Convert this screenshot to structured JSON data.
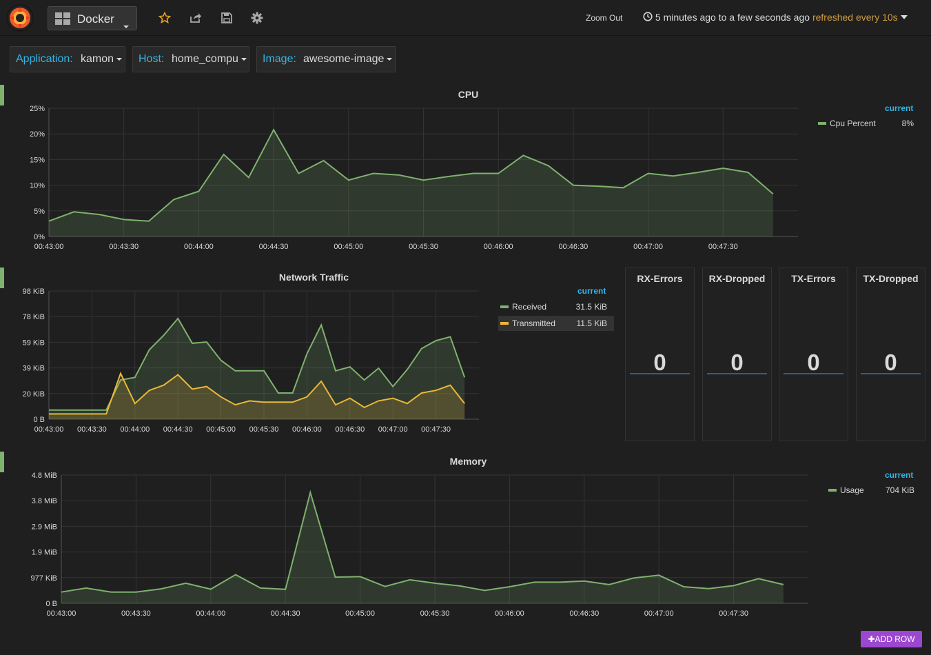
{
  "nav": {
    "dashboard_title": "Docker",
    "zoom_out": "Zoom Out",
    "time_range": "5 minutes ago to a few seconds ago",
    "refresh": "refreshed every 10s"
  },
  "variables": [
    {
      "label": "Application:",
      "value": "kamon"
    },
    {
      "label": "Host:",
      "value": "home_compu"
    },
    {
      "label": "Image:",
      "value": "awesome-image"
    }
  ],
  "cpu": {
    "title": "CPU",
    "legend_header": "current",
    "legend": [
      {
        "name": "Cpu Percent",
        "value": "8%",
        "color": "#7eb26d"
      }
    ]
  },
  "network": {
    "title": "Network Traffic",
    "legend_header": "current",
    "legend": [
      {
        "name": "Received",
        "value": "31.5 KiB",
        "color": "#7eb26d"
      },
      {
        "name": "Transmitted",
        "value": "11.5 KiB",
        "color": "#eab839"
      }
    ]
  },
  "stats": [
    {
      "title": "RX-Errors",
      "value": "0"
    },
    {
      "title": "RX-Dropped",
      "value": "0"
    },
    {
      "title": "TX-Errors",
      "value": "0"
    },
    {
      "title": "TX-Dropped",
      "value": "0"
    }
  ],
  "memory": {
    "title": "Memory",
    "legend_header": "current",
    "legend": [
      {
        "name": "Usage",
        "value": "704 KiB",
        "color": "#7eb26d"
      }
    ]
  },
  "add_row": "ADD ROW",
  "chart_data": [
    {
      "type": "area",
      "title": "CPU",
      "x_ticks": [
        "00:43:00",
        "00:43:30",
        "00:44:00",
        "00:44:30",
        "00:45:00",
        "00:45:30",
        "00:46:00",
        "00:46:30",
        "00:47:00",
        "00:47:30"
      ],
      "y_ticks": [
        "0%",
        "5%",
        "10%",
        "15%",
        "20%",
        "25%"
      ],
      "ylim": [
        0,
        25
      ],
      "x": [
        0,
        10,
        20,
        30,
        40,
        50,
        60,
        70,
        80,
        90,
        100,
        110,
        120,
        130,
        140,
        150,
        160,
        170,
        180,
        190,
        200,
        210,
        220,
        230,
        240,
        250,
        260,
        270,
        280,
        290
      ],
      "series": [
        {
          "name": "Cpu Percent",
          "values": [
            3.0,
            4.8,
            4.3,
            3.3,
            3.0,
            7.2,
            8.8,
            16.0,
            11.5,
            20.8,
            12.3,
            14.8,
            11.0,
            12.3,
            12.0,
            11.0,
            11.7,
            12.3,
            12.3,
            15.8,
            13.8,
            10.0,
            9.8,
            9.5,
            12.3,
            11.8,
            12.5,
            13.3,
            12.5,
            8.3
          ]
        }
      ]
    },
    {
      "type": "area",
      "title": "Network Traffic",
      "x_ticks": [
        "00:43:00",
        "00:43:30",
        "00:44:00",
        "00:44:30",
        "00:45:00",
        "00:45:30",
        "00:46:00",
        "00:46:30",
        "00:47:00",
        "00:47:30"
      ],
      "y_ticks": [
        "0 B",
        "20 KiB",
        "39 KiB",
        "59 KiB",
        "78 KiB",
        "98 KiB"
      ],
      "ylim": [
        0,
        98
      ],
      "x": [
        0,
        10,
        20,
        30,
        40,
        45,
        50,
        55,
        60,
        65,
        70,
        75,
        80,
        85,
        90,
        95,
        100,
        105,
        110,
        115,
        120,
        125,
        130,
        135,
        140,
        145,
        150,
        155,
        160,
        165,
        170,
        175,
        180,
        185,
        190,
        195,
        200,
        205,
        210,
        215,
        220,
        225,
        230,
        235,
        240,
        245,
        250,
        255,
        260,
        265,
        270,
        275,
        280,
        285,
        290
      ],
      "series": [
        {
          "name": "Received",
          "values": [
            7,
            7,
            7,
            7,
            7,
            30,
            32,
            53,
            64,
            77,
            58,
            59,
            45,
            37,
            37,
            37,
            20,
            20,
            50,
            72,
            37,
            40,
            30,
            39,
            25,
            38,
            54,
            60,
            63,
            32
          ]
        },
        {
          "name": "Transmitted",
          "values": [
            4,
            4,
            4,
            4,
            4,
            35,
            12,
            22,
            26,
            34,
            23,
            25,
            17,
            11,
            14,
            13,
            13,
            13,
            17,
            29,
            11,
            16,
            9,
            14,
            16,
            12,
            20,
            22,
            26,
            12
          ]
        }
      ]
    },
    {
      "type": "area",
      "title": "Memory",
      "x_ticks": [
        "00:43:00",
        "00:43:30",
        "00:44:00",
        "00:44:30",
        "00:45:00",
        "00:45:30",
        "00:46:00",
        "00:46:30",
        "00:47:00",
        "00:47:30"
      ],
      "y_ticks": [
        "0 B",
        "977 KiB",
        "1.9 MiB",
        "2.9 MiB",
        "3.8 MiB",
        "4.8 MiB"
      ],
      "ylim": [
        0,
        4.8
      ],
      "series": [
        {
          "name": "Usage",
          "values": [
            0.42,
            0.57,
            0.42,
            0.42,
            0.54,
            0.75,
            0.53,
            1.07,
            0.57,
            0.52,
            4.15,
            0.98,
            1.0,
            0.63,
            0.88,
            0.75,
            0.65,
            0.48,
            0.62,
            0.79,
            0.79,
            0.83,
            0.7,
            0.95,
            1.05,
            0.62,
            0.55,
            0.66,
            0.92,
            0.7
          ]
        }
      ]
    }
  ]
}
